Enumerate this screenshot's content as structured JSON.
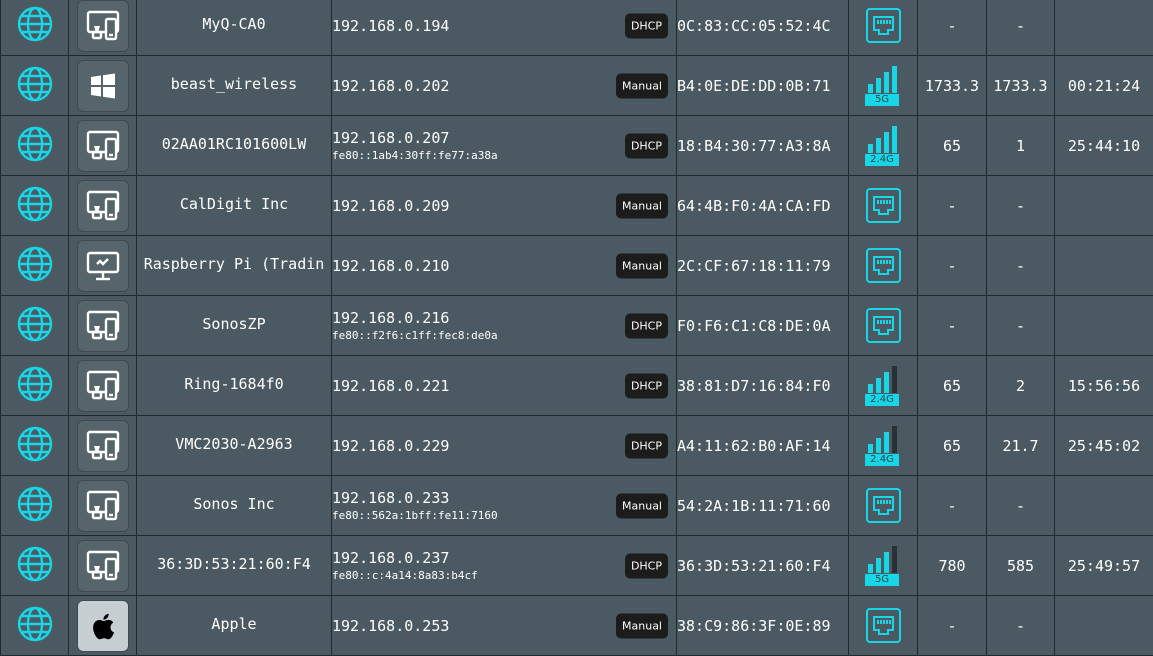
{
  "colors": {
    "accent": "#18d6e6",
    "background": "#4b5a62",
    "border": "#1f2a2f",
    "bar_inactive": "#2a3134"
  },
  "clients": [
    {
      "type_icon": "iot-device-icon",
      "name": "MyQ-CA0",
      "ip": "192.168.0.194",
      "ipv6": "",
      "mode": "DHCP",
      "mac": "0C:83:CC:05:52:4C",
      "interface": "ethernet",
      "band": "",
      "signal": 0,
      "tx": "-",
      "rx": "-",
      "time": ""
    },
    {
      "type_icon": "windows-icon",
      "name": "beast_wireless",
      "ip": "192.168.0.202",
      "ipv6": "",
      "mode": "Manual",
      "mac": "B4:0E:DE:DD:0B:71",
      "interface": "wifi",
      "band": "5G",
      "signal": 4,
      "tx": "1733.3",
      "rx": "1733.3",
      "time": "00:21:24"
    },
    {
      "type_icon": "iot-device-icon",
      "name": "02AA01RC101600LW",
      "ip": "192.168.0.207",
      "ipv6": "fe80::1ab4:30ff:fe77:a38a",
      "mode": "DHCP",
      "mac": "18:B4:30:77:A3:8A",
      "interface": "wifi",
      "band": "2.4G",
      "signal": 4,
      "tx": "65",
      "rx": "1",
      "time": "25:44:10"
    },
    {
      "type_icon": "iot-device-icon",
      "name": "CalDigit Inc",
      "ip": "192.168.0.209",
      "ipv6": "",
      "mode": "Manual",
      "mac": "64:4B:F0:4A:CA:FD",
      "interface": "ethernet",
      "band": "",
      "signal": 0,
      "tx": "-",
      "rx": "-",
      "time": ""
    },
    {
      "type_icon": "desktop-icon",
      "name": "Raspberry Pi (Tradin",
      "ip": "192.168.0.210",
      "ipv6": "",
      "mode": "Manual",
      "mac": "2C:CF:67:18:11:79",
      "interface": "ethernet",
      "band": "",
      "signal": 0,
      "tx": "-",
      "rx": "-",
      "time": ""
    },
    {
      "type_icon": "iot-device-icon",
      "name": "SonosZP",
      "ip": "192.168.0.216",
      "ipv6": "fe80::f2f6:c1ff:fec8:de0a",
      "mode": "DHCP",
      "mac": "F0:F6:C1:C8:DE:0A",
      "interface": "ethernet",
      "band": "",
      "signal": 0,
      "tx": "-",
      "rx": "-",
      "time": ""
    },
    {
      "type_icon": "iot-device-icon",
      "name": "Ring-1684f0",
      "ip": "192.168.0.221",
      "ipv6": "",
      "mode": "DHCP",
      "mac": "38:81:D7:16:84:F0",
      "interface": "wifi",
      "band": "2.4G",
      "signal": 3,
      "tx": "65",
      "rx": "2",
      "time": "15:56:56"
    },
    {
      "type_icon": "iot-device-icon",
      "name": "VMC2030-A2963",
      "ip": "192.168.0.229",
      "ipv6": "",
      "mode": "DHCP",
      "mac": "A4:11:62:B0:AF:14",
      "interface": "wifi",
      "band": "2.4G",
      "signal": 3,
      "tx": "65",
      "rx": "21.7",
      "time": "25:45:02"
    },
    {
      "type_icon": "iot-device-icon",
      "name": "Sonos Inc",
      "ip": "192.168.0.233",
      "ipv6": "fe80::562a:1bff:fe11:7160",
      "mode": "Manual",
      "mac": "54:2A:1B:11:71:60",
      "interface": "ethernet",
      "band": "",
      "signal": 0,
      "tx": "-",
      "rx": "-",
      "time": ""
    },
    {
      "type_icon": "iot-device-icon",
      "name": "36:3D:53:21:60:F4",
      "ip": "192.168.0.237",
      "ipv6": "fe80::c:4a14:8a83:b4cf",
      "mode": "DHCP",
      "mac": "36:3D:53:21:60:F4",
      "interface": "wifi",
      "band": "5G",
      "signal": 3,
      "tx": "780",
      "rx": "585",
      "time": "25:49:57"
    },
    {
      "type_icon": "apple-icon",
      "name": "Apple",
      "ip": "192.168.0.253",
      "ipv6": "",
      "mode": "Manual",
      "mac": "38:C9:86:3F:0E:89",
      "interface": "ethernet",
      "band": "",
      "signal": 0,
      "tx": "-",
      "rx": "-",
      "time": ""
    }
  ]
}
